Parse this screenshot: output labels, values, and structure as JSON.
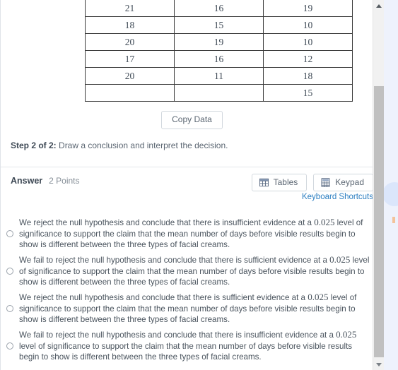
{
  "table": {
    "name": "data-table",
    "columns": 3,
    "rows": [
      [
        "21",
        "16",
        "19"
      ],
      [
        "18",
        "15",
        "10"
      ],
      [
        "20",
        "19",
        "10"
      ],
      [
        "17",
        "16",
        "12"
      ],
      [
        "20",
        "11",
        "18"
      ],
      [
        "",
        "",
        "15"
      ]
    ]
  },
  "copy_data_button": "Copy Data",
  "step": {
    "label": "Step 2 of 2:",
    "text": " Draw a conclusion and interpret the decision."
  },
  "answer": {
    "title": "Answer",
    "points": "2 Points",
    "tables_button": "Tables",
    "keypad_button": "Keypad",
    "keyboard_shortcuts": "Keyboard Shortcuts",
    "tables_icon": "table-grid-icon",
    "keypad_icon": "calculator-icon"
  },
  "options": [
    {
      "part1": "We reject the null hypothesis and conclude that there is insufficient evidence at a ",
      "alpha": "0.025",
      "part2": " level of significance to support the claim that the mean number of days before visible results begin to show is different between the three types of facial creams.",
      "selected": false
    },
    {
      "part1": "We fail to reject the null hypothesis and conclude that there is sufficient evidence at a ",
      "alpha": "0.025",
      "part2": " level of significance to support the claim that the mean number of days before visible results begin to show is different between the three types of facial creams.",
      "selected": false
    },
    {
      "part1": "We reject the null hypothesis and conclude that there is sufficient evidence at a ",
      "alpha": "0.025",
      "part2": " level of significance to support the claim that the mean number of days before visible results begin to show is different between the three types of facial creams.",
      "selected": false
    },
    {
      "part1": "We fail to reject the null hypothesis and conclude that there is insufficient evidence at a ",
      "alpha": "0.025",
      "part2": " level of significance to support the claim that the mean number of days before visible results begin to show is different between the three types of facial creams.",
      "selected": false
    }
  ],
  "scrollbar": {
    "up_arrow_icon": "chevron-up-icon",
    "down_arrow_icon": "chevron-down-icon",
    "thumb": "scroll-thumb"
  },
  "colors": {
    "link": "#2b7ec1",
    "panel_bg": "#ffffff",
    "page_bg": "#eef2fb",
    "text": "#4a545e",
    "border": "#d2d8de",
    "table_border": "#3a3a3a",
    "scroll_thumb": "#c0c0c0"
  }
}
